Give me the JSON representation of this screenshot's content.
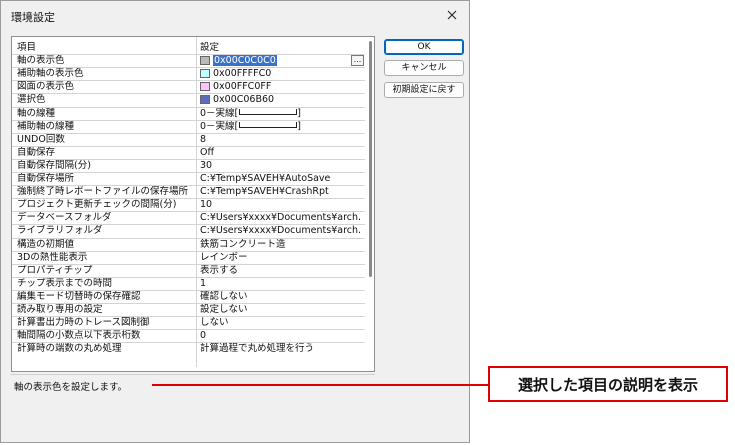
{
  "window": {
    "title": "環境設定"
  },
  "grid": {
    "columns": [
      "項目",
      "設定"
    ],
    "rows": [
      {
        "label": "軸の表示色",
        "value": "0x00C0C0C0",
        "swatch": "#b9b9b9",
        "selected": true,
        "has_button": true,
        "button_label": "..."
      },
      {
        "label": "補助軸の表示色",
        "value": "0x00FFFFC0",
        "swatch": "#c0ffff"
      },
      {
        "label": "図面の表示色",
        "value": "0x00FFC0FF",
        "swatch": "#ffc0ff"
      },
      {
        "label": "選択色",
        "value": "0x00C06B60",
        "swatch": "#606bc0"
      },
      {
        "label": "軸の線種",
        "value": "0－実線[",
        "line_style": true
      },
      {
        "label": "補助軸の線種",
        "value": "0－実線[",
        "line_style": true
      },
      {
        "label": "UNDO回数",
        "value": "8"
      },
      {
        "label": "自動保存",
        "value": "Off"
      },
      {
        "label": "自動保存間隔(分)",
        "value": "30"
      },
      {
        "label": "自動保存場所",
        "value": "C:¥Temp¥SAVEH¥AutoSave"
      },
      {
        "label": "強制終了時レポートファイルの保存場所",
        "value": "C:¥Temp¥SAVEH¥CrashRpt"
      },
      {
        "label": "プロジェクト更新チェックの間隔(分)",
        "value": "10"
      },
      {
        "label": "データベースフォルダ",
        "value": "C:¥Users¥xxxx¥Documents¥arch..."
      },
      {
        "label": "ライブラリフォルダ",
        "value": "C:¥Users¥xxxx¥Documents¥arch..."
      },
      {
        "label": "構造の初期値",
        "value": "鉄筋コンクリート造"
      },
      {
        "label": "3Dの熱性能表示",
        "value": "レインボー"
      },
      {
        "label": "プロパティチップ",
        "value": "表示する"
      },
      {
        "label": "チップ表示までの時間",
        "value": "1"
      },
      {
        "label": "編集モード切替時の保存確認",
        "value": "確認しない"
      },
      {
        "label": "読み取り専用の設定",
        "value": "設定しない"
      },
      {
        "label": "計算書出力時のトレース図制御",
        "value": "しない"
      },
      {
        "label": "軸間隔の小数点以下表示桁数",
        "value": "0"
      },
      {
        "label": "計算時の端数の丸め処理",
        "value": "計算過程で丸め処理を行う"
      }
    ]
  },
  "description": "軸の表示色を設定します。",
  "buttons": {
    "ok": "OK",
    "cancel": "キャンセル",
    "reset": "初期設定に戻す"
  },
  "callout": {
    "text": "選択した項目の説明を表示",
    "color": "#e00000"
  },
  "icons": {
    "close": "close-icon",
    "ellipsis": "ellipsis-icon"
  }
}
